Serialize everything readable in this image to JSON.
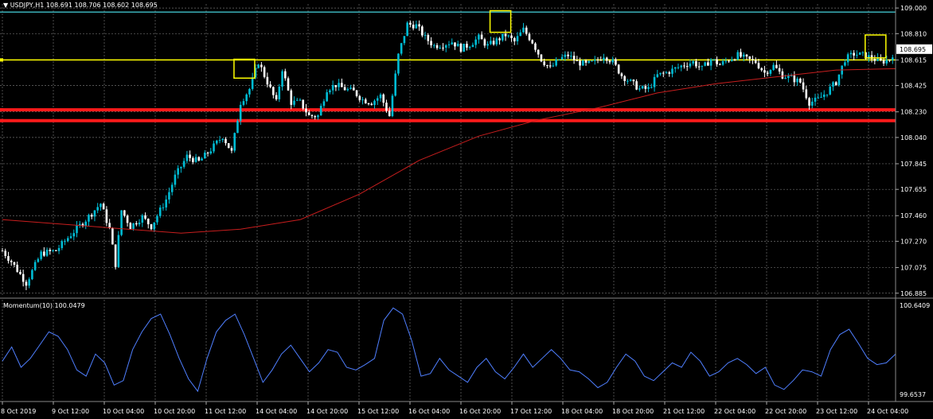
{
  "header": {
    "title": "USDJPY,H1  108.691 108.706 108.602 108.695"
  },
  "indicator": {
    "title": "Momentum(10) 100.0479"
  },
  "price_scale": [
    "109.000",
    "108.810",
    "108.615",
    "108.425",
    "108.230",
    "108.040",
    "107.845",
    "107.655",
    "107.460",
    "107.270",
    "107.075",
    "106.885"
  ],
  "momentum_scale": [
    "100.6409",
    "99.6537"
  ],
  "current_price": "108.695",
  "x_labels": [
    "8 Oct 2019",
    "9 Oct 12:00",
    "10 Oct 04:00",
    "10 Oct 20:00",
    "11 Oct 12:00",
    "14 Oct 04:00",
    "14 Oct 20:00",
    "15 Oct 12:00",
    "16 Oct 04:00",
    "16 Oct 20:00",
    "17 Oct 12:00",
    "18 Oct 04:00",
    "18 Oct 20:00",
    "21 Oct 12:00",
    "22 Oct 04:00",
    "22 Oct 20:00",
    "23 Oct 12:00",
    "24 Oct 04:00"
  ],
  "colors": {
    "background": "#000000",
    "bull": "#00bcd4",
    "bear": "#ffffff",
    "grid": "#6e6e6e",
    "ma": "#c81e1e",
    "support": "#ff1a1a",
    "yellow": "#ffff00",
    "resistance_top": "#40c0c8",
    "momentum": "#4f7fff",
    "box": "#ffff00"
  },
  "chart_data": [
    {
      "type": "candlestick",
      "title": "USDJPY,H1",
      "ylim": [
        106.86,
        109.03
      ],
      "levels": [
        {
          "value": 108.615,
          "color": "yellow"
        },
        {
          "value": 108.97,
          "color": "cyan"
        },
        {
          "value": 108.245,
          "color": "red"
        },
        {
          "value": 108.165,
          "color": "red"
        }
      ],
      "close_path": [
        [
          0,
          107.2
        ],
        [
          3,
          107.12
        ],
        [
          8,
          106.96
        ],
        [
          13,
          107.18
        ],
        [
          18,
          107.2
        ],
        [
          23,
          107.32
        ],
        [
          28,
          107.43
        ],
        [
          33,
          107.55
        ],
        [
          36,
          107.36
        ],
        [
          38,
          107.1
        ],
        [
          40,
          107.5
        ],
        [
          43,
          107.38
        ],
        [
          47,
          107.45
        ],
        [
          50,
          107.38
        ],
        [
          55,
          107.58
        ],
        [
          58,
          107.75
        ],
        [
          62,
          107.9
        ],
        [
          66,
          107.86
        ],
        [
          70,
          107.95
        ],
        [
          74,
          108.05
        ],
        [
          77,
          107.93
        ],
        [
          80,
          108.3
        ],
        [
          83,
          108.4
        ],
        [
          86,
          108.6
        ],
        [
          89,
          108.45
        ],
        [
          92,
          108.3
        ],
        [
          94,
          108.55
        ],
        [
          97,
          108.3
        ],
        [
          100,
          108.3
        ],
        [
          103,
          108.2
        ],
        [
          106,
          108.2
        ],
        [
          109,
          108.4
        ],
        [
          112,
          108.43
        ],
        [
          115,
          108.4
        ],
        [
          118,
          108.38
        ],
        [
          121,
          108.32
        ],
        [
          124,
          108.3
        ],
        [
          127,
          108.35
        ],
        [
          130,
          108.2
        ],
        [
          133,
          108.65
        ],
        [
          136,
          108.88
        ],
        [
          139,
          108.87
        ],
        [
          142,
          108.78
        ],
        [
          145,
          108.72
        ],
        [
          148,
          108.73
        ],
        [
          151,
          108.75
        ],
        [
          154,
          108.7
        ],
        [
          157,
          108.73
        ],
        [
          160,
          108.78
        ],
        [
          163,
          108.72
        ],
        [
          166,
          108.76
        ],
        [
          169,
          108.8
        ],
        [
          172,
          108.75
        ],
        [
          175,
          108.84
        ],
        [
          178,
          108.75
        ],
        [
          181,
          108.62
        ],
        [
          184,
          108.55
        ],
        [
          187,
          108.62
        ],
        [
          190,
          108.65
        ],
        [
          193,
          108.6
        ],
        [
          196,
          108.58
        ],
        [
          199,
          108.6
        ],
        [
          202,
          108.65
        ],
        [
          205,
          108.6
        ],
        [
          208,
          108.5
        ],
        [
          211,
          108.45
        ],
        [
          214,
          108.4
        ],
        [
          217,
          108.4
        ],
        [
          220,
          108.5
        ],
        [
          223,
          108.52
        ],
        [
          226,
          108.55
        ],
        [
          229,
          108.58
        ],
        [
          232,
          108.6
        ],
        [
          235,
          108.55
        ],
        [
          238,
          108.62
        ],
        [
          241,
          108.58
        ],
        [
          244,
          108.62
        ],
        [
          247,
          108.65
        ],
        [
          250,
          108.62
        ],
        [
          253,
          108.6
        ],
        [
          256,
          108.52
        ],
        [
          259,
          108.57
        ],
        [
          262,
          108.5
        ],
        [
          265,
          108.48
        ],
        [
          268,
          108.45
        ],
        [
          271,
          108.3
        ],
        [
          274,
          108.32
        ],
        [
          277,
          108.38
        ],
        [
          280,
          108.45
        ],
        [
          283,
          108.62
        ],
        [
          286,
          108.66
        ],
        [
          289,
          108.65
        ],
        [
          292,
          108.63
        ],
        [
          295,
          108.6
        ],
        [
          298,
          108.62
        ],
        [
          300,
          108.695
        ]
      ],
      "ma_path": [
        [
          0,
          107.43
        ],
        [
          30,
          107.38
        ],
        [
          60,
          107.33
        ],
        [
          80,
          107.36
        ],
        [
          100,
          107.43
        ],
        [
          120,
          107.62
        ],
        [
          140,
          107.87
        ],
        [
          160,
          108.05
        ],
        [
          180,
          108.17
        ],
        [
          200,
          108.26
        ],
        [
          220,
          108.37
        ],
        [
          240,
          108.44
        ],
        [
          260,
          108.49
        ],
        [
          280,
          108.54
        ],
        [
          300,
          108.55
        ]
      ]
    },
    {
      "type": "line",
      "title": "Momentum(10)",
      "ylim": [
        99.6537,
        100.6409
      ],
      "values": [
        100.02,
        100.18,
        99.95,
        100.05,
        100.2,
        100.35,
        100.3,
        100.15,
        99.92,
        99.85,
        100.1,
        100.0,
        99.75,
        99.8,
        100.15,
        100.35,
        100.5,
        100.55,
        100.32,
        100.05,
        99.82,
        99.68,
        100.05,
        100.35,
        100.48,
        100.55,
        100.32,
        100.05,
        99.78,
        99.92,
        100.1,
        100.2,
        100.05,
        99.9,
        100.0,
        100.15,
        100.12,
        99.95,
        99.92,
        99.98,
        100.05,
        100.48,
        100.62,
        100.55,
        100.25,
        99.85,
        99.88,
        100.05,
        99.92,
        99.85,
        99.78,
        99.95,
        100.05,
        99.9,
        99.82,
        99.95,
        100.1,
        99.95,
        100.05,
        100.15,
        100.05,
        99.92,
        99.9,
        99.82,
        99.72,
        99.78,
        99.95,
        100.1,
        100.02,
        99.85,
        99.8,
        99.9,
        100.0,
        99.95,
        100.12,
        100.02,
        99.85,
        99.9,
        100.0,
        100.05,
        99.98,
        99.88,
        99.95,
        99.75,
        99.7,
        99.8,
        99.92,
        99.9,
        99.85,
        100.15,
        100.32,
        100.38,
        100.22,
        100.05,
        99.98,
        100.0,
        100.1
      ]
    }
  ]
}
